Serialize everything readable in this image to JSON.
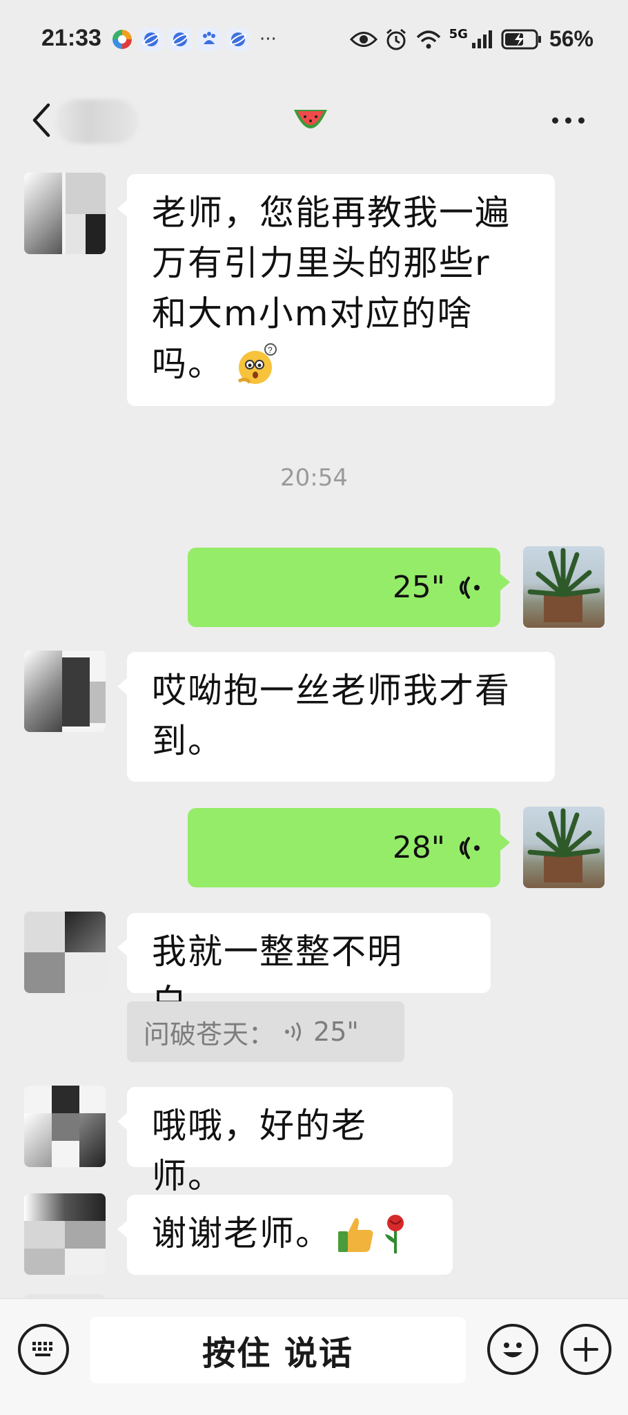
{
  "status_bar": {
    "time": "21:33",
    "more": "···",
    "network": "5G",
    "battery_percent": "56%"
  },
  "nav": {
    "title_icon": "watermelon-icon",
    "more_icon": "more-icon"
  },
  "messages": [
    {
      "side": "in",
      "text_lines": [
        "老师，您能再教我一遍",
        "万有引力里头的那些r",
        "和大m小m对应的啥",
        "吗。"
      ],
      "emoji": "thinking-face-emoji"
    },
    {
      "type": "time",
      "text": "20:54"
    },
    {
      "side": "out",
      "voice_duration": "25\""
    },
    {
      "side": "in",
      "text_lines": [
        "哎呦抱一丝老师我才看",
        "到。"
      ]
    },
    {
      "side": "out",
      "voice_duration": "28\""
    },
    {
      "side": "in",
      "text_lines": [
        "我就一整整不明白。"
      ]
    },
    {
      "type": "quote",
      "sender": "问破苍天：",
      "voice_duration": "25\""
    },
    {
      "side": "in",
      "text_lines": [
        "哦哦，好的老师。"
      ]
    },
    {
      "side": "in",
      "text_lines": [
        "谢谢老师。"
      ],
      "emoji": [
        "thumbs-up-emoji",
        "rose-emoji"
      ]
    }
  ],
  "input_bar": {
    "hold_to_talk": "按住 说话"
  },
  "colors": {
    "background": "#ededed",
    "outgoing_bubble": "#95ec69",
    "incoming_bubble": "#ffffff"
  }
}
